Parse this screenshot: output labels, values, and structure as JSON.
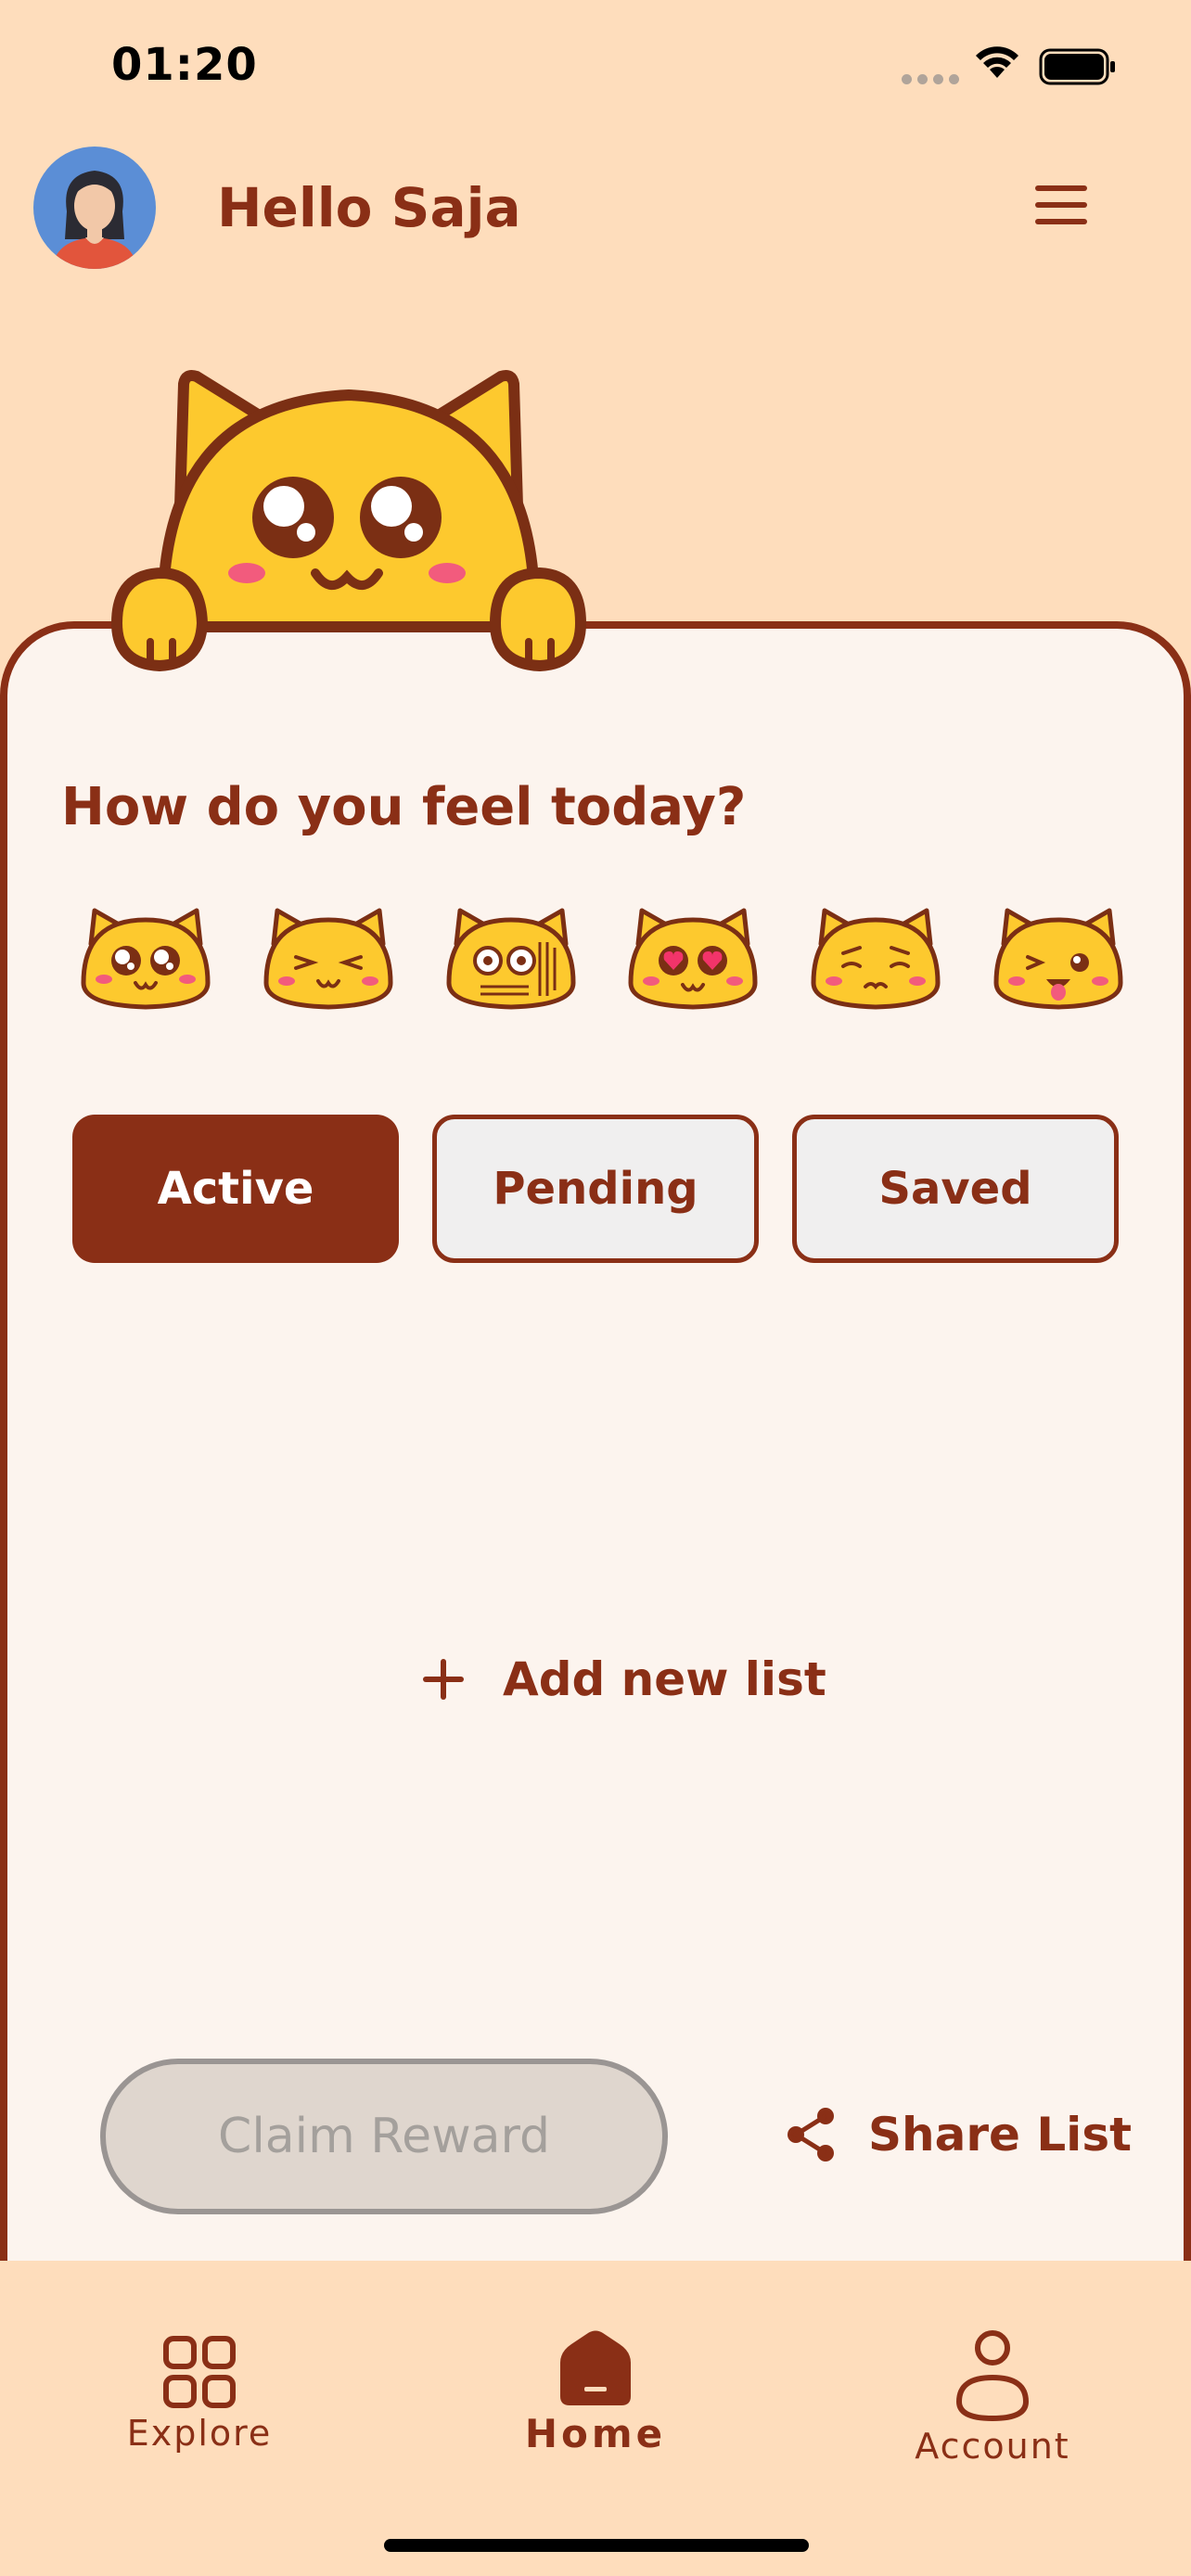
{
  "status_bar": {
    "time": "01:20"
  },
  "header": {
    "greeting": "Hello Saja"
  },
  "mood_section": {
    "question": "How do you feel today?",
    "moods": [
      "excited",
      "content",
      "confused",
      "in-love",
      "sad",
      "playful"
    ]
  },
  "tabs": [
    {
      "label": "Active",
      "selected": true
    },
    {
      "label": "Pending",
      "selected": false
    },
    {
      "label": "Saved",
      "selected": false
    }
  ],
  "main": {
    "add_list_label": "Add new list"
  },
  "actions": {
    "claim_reward_label": "Claim Reward",
    "share_list_label": "Share List"
  },
  "bottom_nav": [
    {
      "label": "Explore",
      "icon": "grid-icon",
      "active": false
    },
    {
      "label": "Home",
      "icon": "home-icon",
      "active": true
    },
    {
      "label": "Account",
      "icon": "person-icon",
      "active": false
    }
  ],
  "colors": {
    "background": "#FEDDBC",
    "brand": "#8A2F16",
    "card": "#FCF4EE",
    "mascot": "#FDC92E",
    "disabled": "#DFD6CE"
  }
}
